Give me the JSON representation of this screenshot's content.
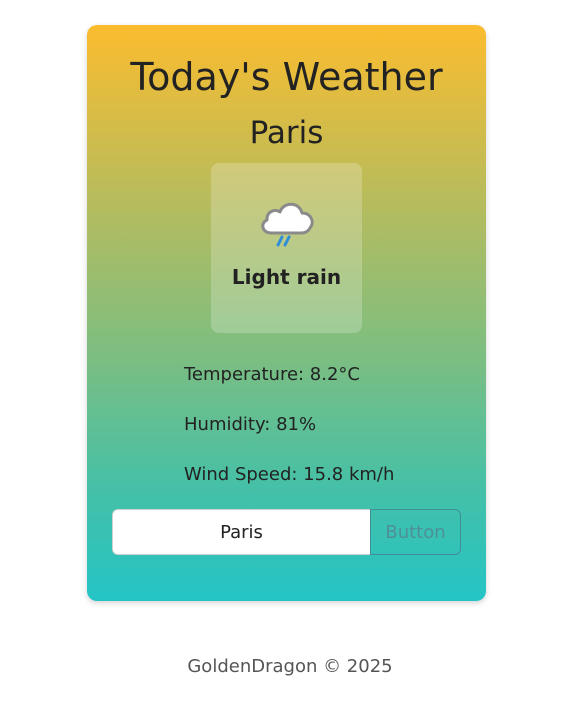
{
  "card": {
    "title": "Today's Weather",
    "city": "Paris",
    "condition": {
      "icon": "cloud-rain-icon",
      "text": "Light rain"
    },
    "details": {
      "temperature": "Temperature: 8.2°C",
      "humidity": "Humidity: 81%",
      "wind_speed": "Wind Speed: 15.8 km/h"
    },
    "search": {
      "value": "Paris",
      "button_label": "Button"
    }
  },
  "footer": {
    "text": "GoldenDragon © 2025"
  },
  "colors": {
    "gradient_top": "#fbbc2e",
    "gradient_bottom": "#24c4c6",
    "text": "#222222"
  }
}
